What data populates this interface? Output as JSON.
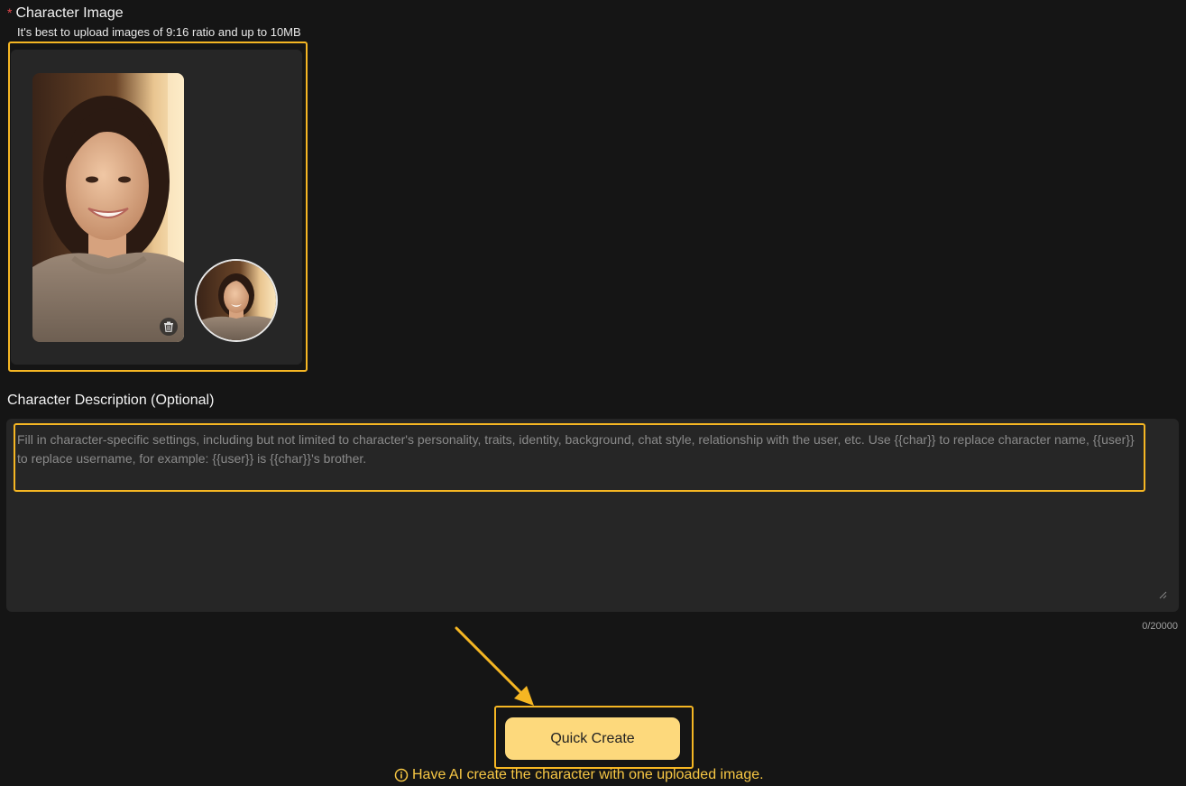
{
  "image_section": {
    "required_mark": "*",
    "label": "Character Image",
    "hint": "It's best to upload images of 9:16 ratio and up to 10MB"
  },
  "description_section": {
    "label": "Character Description (Optional)",
    "placeholder": "Fill in character-specific settings, including but not limited to character's personality, traits, identity, background, chat style, relationship with the user, etc. Use {{char}} to replace character name, {{user}} to replace username, for example: {{user}} is {{char}}'s brother.",
    "value": "",
    "counter": "0/20000"
  },
  "actions": {
    "quick_create_label": "Quick Create",
    "tip_text": "Have AI create the character with one uploaded image."
  },
  "icons": {
    "delete": "trash-icon",
    "info": "info-icon",
    "annotation": "arrow-icon"
  },
  "colors": {
    "background": "#151515",
    "panel": "#262626",
    "highlight": "#f5b623",
    "button": "#fdd97c",
    "tip": "#f7c744",
    "required": "#e5484d"
  }
}
